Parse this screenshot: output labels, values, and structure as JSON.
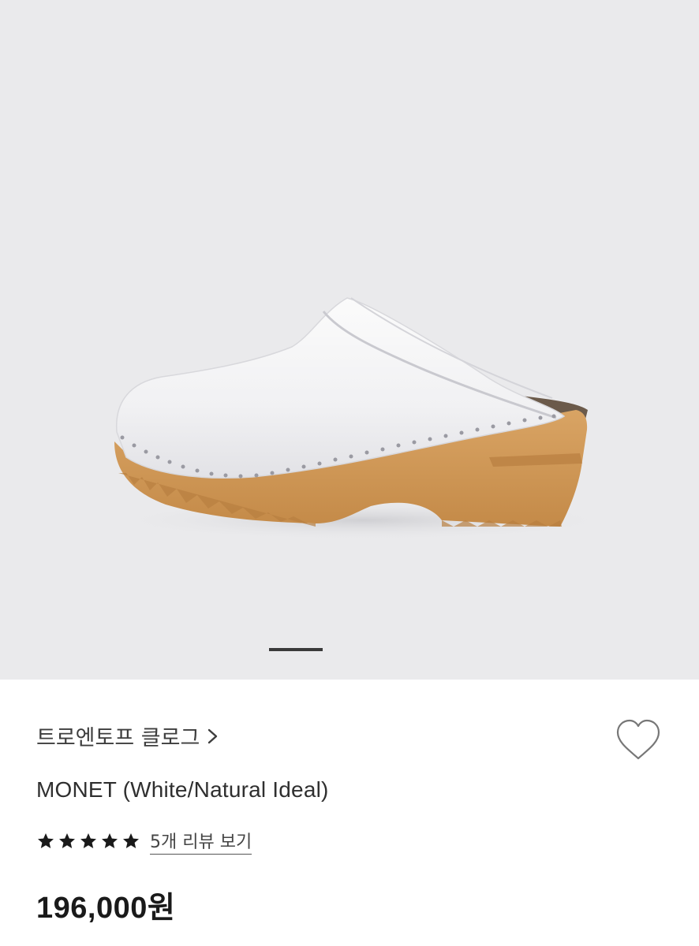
{
  "gallery": {
    "image_subject": "shoe-image",
    "slide_index": 1
  },
  "brand": {
    "label": "트로엔토프 클로그"
  },
  "product": {
    "name": "MONET (White/Natural Ideal)",
    "price": "196,000원"
  },
  "rating": {
    "stars": 5,
    "max_stars": 5,
    "review_link": "5개 리뷰 보기"
  },
  "icons": {
    "wishlist": "heart-icon",
    "brand_arrow": "chevron-right-icon",
    "star": "star-icon"
  },
  "colors": {
    "image_background": "#eaeaec",
    "text": "#2f2f2f",
    "star": "#1a1a1a"
  }
}
